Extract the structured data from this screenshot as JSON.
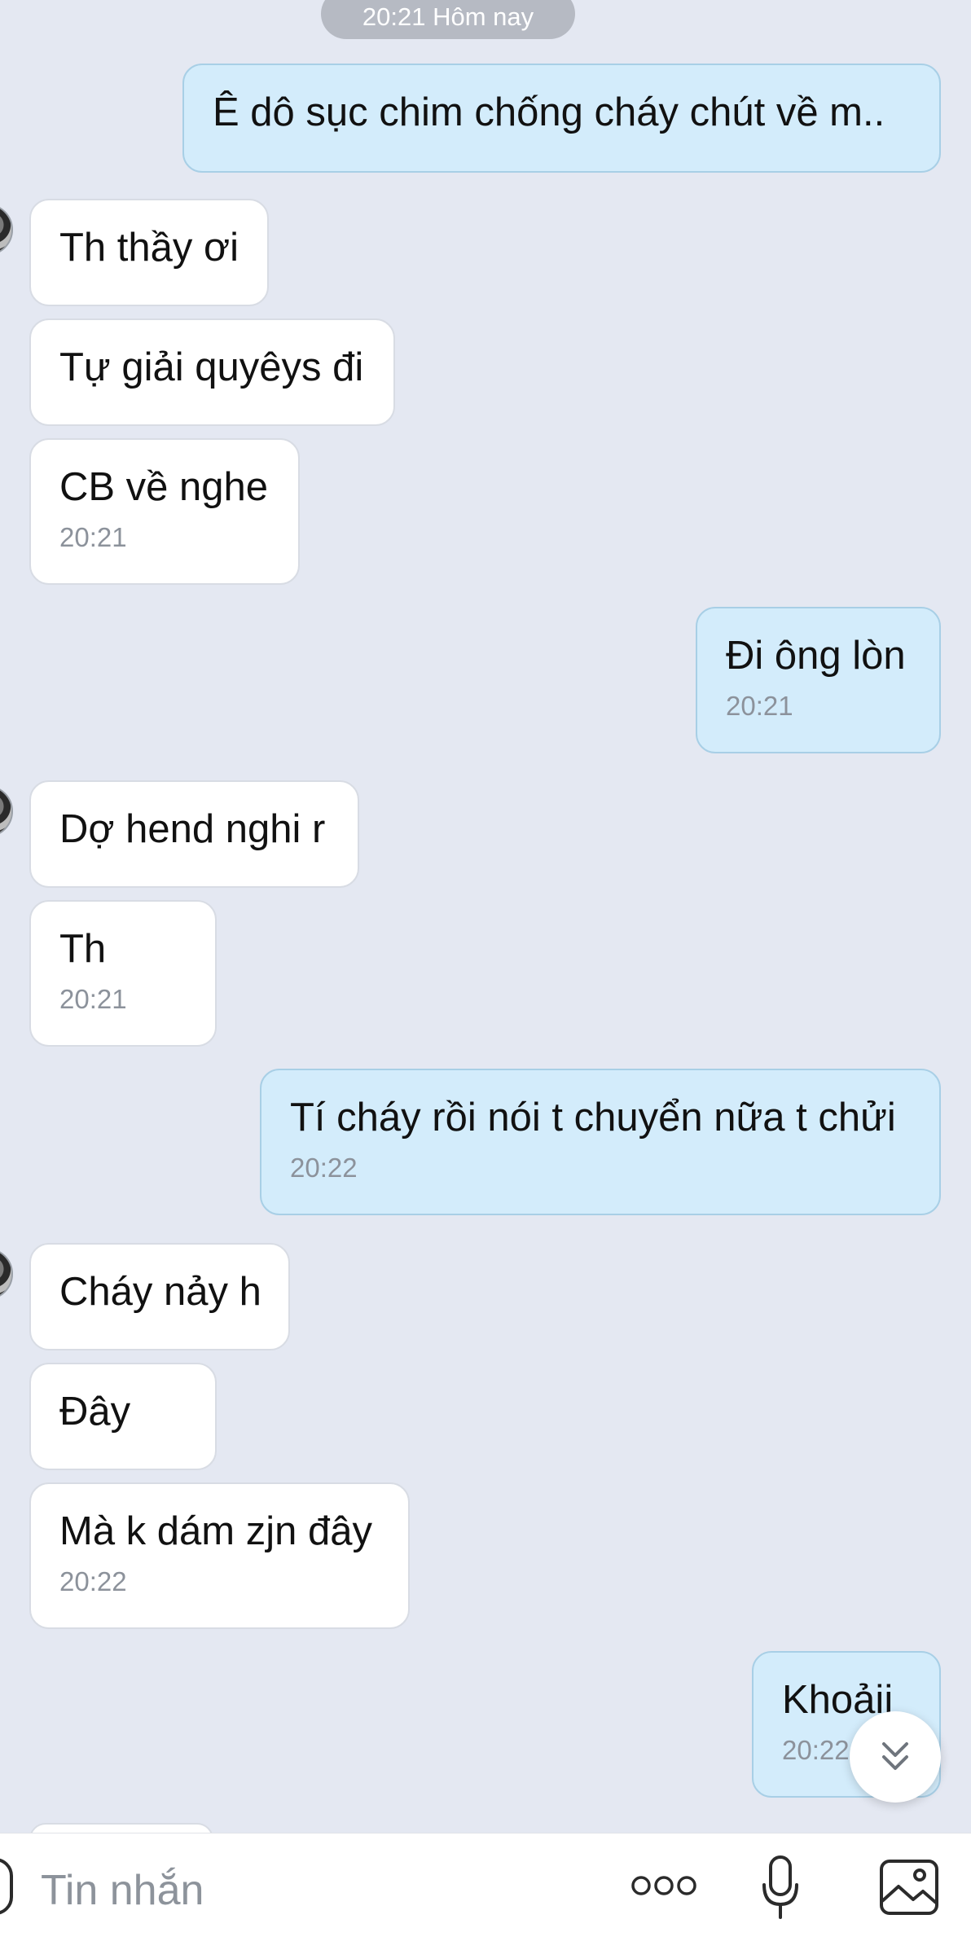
{
  "date_separator": "20:21 Hôm nay",
  "messages": [
    {
      "text": "Ê dô sục chim chống cháy chút về m..",
      "time": ""
    },
    {
      "text": "Th thầy ơi",
      "time": ""
    },
    {
      "text": "Tự giải quyêys đi",
      "time": ""
    },
    {
      "text": "CB về nghe",
      "time": "20:21"
    },
    {
      "text": "Đi ông lòn",
      "time": "20:21"
    },
    {
      "text": "Dợ hend nghi r",
      "time": ""
    },
    {
      "text": "Th",
      "time": "20:21"
    },
    {
      "text": "Tí cháy rồi nói t chuyển nữa t chửi",
      "time": "20:22"
    },
    {
      "text": "Cháy nảy h",
      "time": ""
    },
    {
      "text": "Đây",
      "time": ""
    },
    {
      "text": "Mà k dám zjn đây",
      "time": "20:22"
    },
    {
      "text": "Khoảii",
      "time": "20:22"
    }
  ],
  "input": {
    "placeholder": "Tin nhắn"
  },
  "icons": {
    "scroll_down": "double-chevron-down-icon",
    "more": "more-dots-icon",
    "mic": "microphone-icon",
    "image": "image-icon"
  },
  "colors": {
    "background": "#e4e8f2",
    "incoming_bubble": "#ffffff",
    "outgoing_bubble": "#d3ecfb",
    "timestamp": "#8c929b"
  }
}
